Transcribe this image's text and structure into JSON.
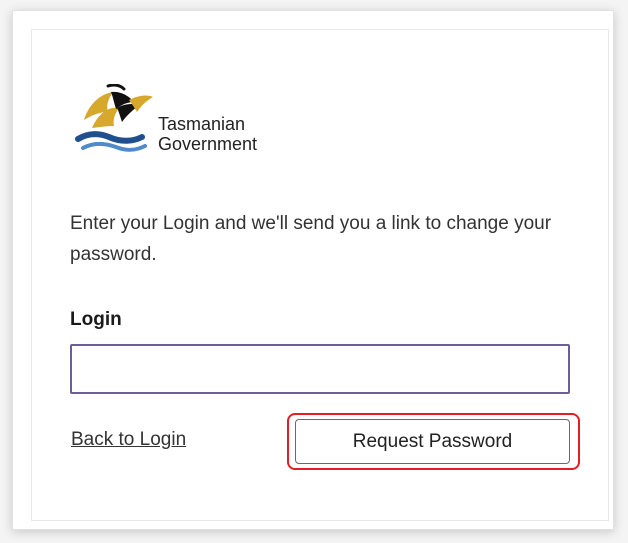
{
  "logo": {
    "line1": "Tasmanian",
    "line2": "Government",
    "icon": "tasmanian-tiger-emblem"
  },
  "form": {
    "intro": "Enter your Login and we'll send you a link to change your password.",
    "login_label": "Login",
    "login_value": "",
    "back_link": "Back to Login",
    "submit_label": "Request Password"
  },
  "colors": {
    "input_border": "#6c5f93",
    "highlight": "#e31e24",
    "logo_gold": "#d6a92d",
    "logo_blue": "#1f4f8f",
    "logo_black": "#111111"
  }
}
